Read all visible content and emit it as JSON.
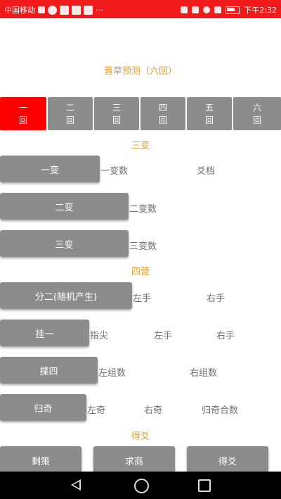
{
  "status_bar": {
    "carrier": "中国移动",
    "time": "下午2:32"
  },
  "title": "蓍草预测（六回）",
  "tabs": [
    {
      "top": "一",
      "bottom": "回"
    },
    {
      "top": "二",
      "bottom": "回"
    },
    {
      "top": "三",
      "bottom": "回"
    },
    {
      "top": "四",
      "bottom": "回"
    },
    {
      "top": "五",
      "bottom": "回"
    },
    {
      "top": "六",
      "bottom": "回"
    }
  ],
  "sections": {
    "three_changes": "三变",
    "four_ying": "四营",
    "get_yao": "得爻"
  },
  "changes": [
    {
      "button": "一变",
      "count_label": "一变数",
      "extra_label": "爻档"
    },
    {
      "button": "二变",
      "count_label": "二变数"
    },
    {
      "button": "三变",
      "count_label": "三变数"
    }
  ],
  "ying": {
    "split": {
      "button": "分二(随机产生)",
      "left": "左手",
      "right": "右手"
    },
    "hang": {
      "button": "挂一",
      "fingertip": "指尖",
      "left": "左手",
      "right": "右手"
    },
    "count4": {
      "button": "揲四",
      "left": "左组数",
      "right": "右组数"
    },
    "return": {
      "button": "归奇",
      "left": "左奇",
      "right": "右奇",
      "sum": "归奇合数"
    }
  },
  "bottom_buttons": [
    "剩策",
    "求商",
    "得爻"
  ]
}
